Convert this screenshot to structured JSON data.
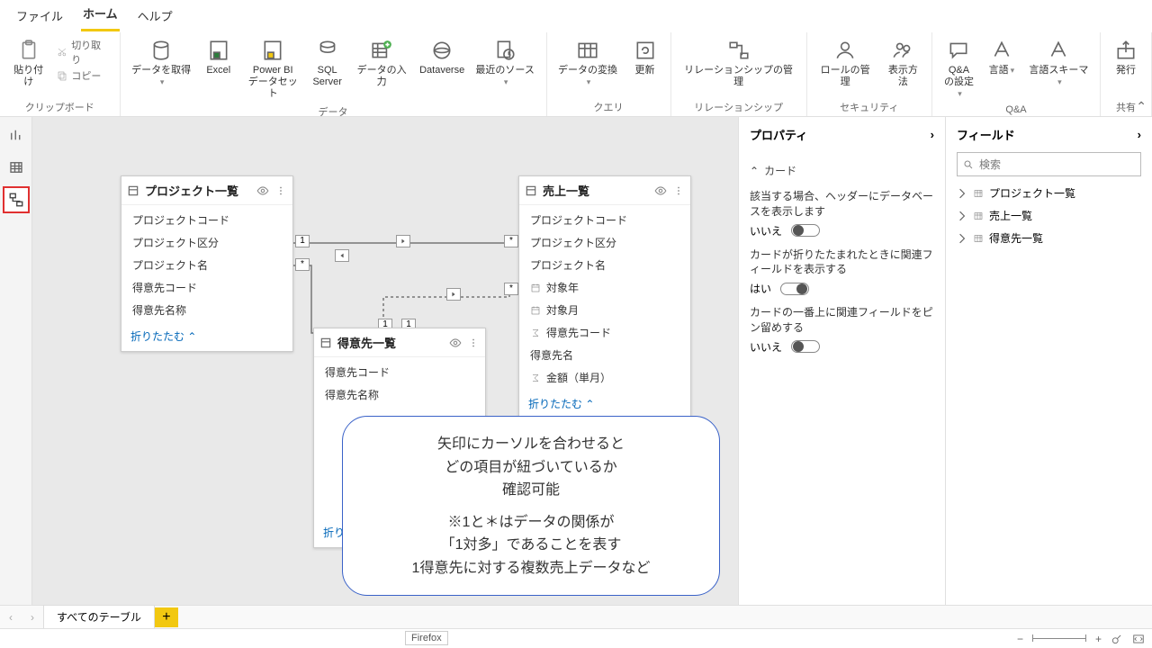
{
  "tabs": {
    "file": "ファイル",
    "home": "ホーム",
    "help": "ヘルプ"
  },
  "ribbon": {
    "clipboard": {
      "paste": "貼り付け",
      "cut": "切り取り",
      "copy": "コピー",
      "group": "クリップボード"
    },
    "data": {
      "getdata": "データを取得",
      "excel": "Excel",
      "pbi": "Power BI\nデータセット",
      "sql": "SQL\nServer",
      "entry": "データの入力",
      "dataverse": "Dataverse",
      "recent": "最近のソース",
      "group": "データ"
    },
    "query": {
      "transform": "データの変換",
      "refresh": "更新",
      "group": "クエリ"
    },
    "rel": {
      "manage": "リレーションシップの管理",
      "group": "リレーションシップ"
    },
    "sec": {
      "role": "ロールの管理",
      "view": "表示方法",
      "group": "セキュリティ"
    },
    "qa": {
      "qaset": "Q&A\nの設定",
      "lang": "言語",
      "schema": "言語スキーマ",
      "group": "Q&A"
    },
    "share": {
      "publish": "発行",
      "group": "共有"
    }
  },
  "tables": {
    "project": {
      "title": "プロジェクト一覧",
      "fields": [
        "プロジェクトコード",
        "プロジェクト区分",
        "プロジェクト名",
        "得意先コード",
        "得意先名称"
      ],
      "collapse": "折りたたむ"
    },
    "sales": {
      "title": "売上一覧",
      "fields": [
        "プロジェクトコード",
        "プロジェクト区分",
        "プロジェクト名",
        "対象年",
        "対象月",
        "得意先コード",
        "得意先名",
        "金額（単月）"
      ],
      "collapse": "折りたたむ"
    },
    "customer": {
      "title": "得意先一覧",
      "fields": [
        "得意先コード",
        "得意先名称"
      ],
      "collapse": "折りたたむ"
    }
  },
  "rel": {
    "one": "1",
    "many": "*"
  },
  "props": {
    "title": "プロパティ",
    "section": "カード",
    "opt1": "該当する場合、ヘッダーにデータベースを表示します",
    "opt2": "カードが折りたたまれたときに関連フィールドを表示する",
    "opt3": "カードの一番上に関連フィールドをピン留めする",
    "no": "いいえ",
    "yes": "はい"
  },
  "fieldsPane": {
    "title": "フィールド",
    "search": "検索",
    "items": [
      "プロジェクト一覧",
      "売上一覧",
      "得意先一覧"
    ]
  },
  "footer": {
    "alltables": "すべてのテーブル"
  },
  "status": {
    "firefox": "Firefox"
  },
  "callout": {
    "l1": "矢印にカーソルを合わせると",
    "l2": "どの項目が紐づいているか",
    "l3": "確認可能",
    "l4": "※1と＊はデータの関係が",
    "l5": "「1対多」であることを表す",
    "l6": "1得意先に対する複数売上データなど"
  }
}
